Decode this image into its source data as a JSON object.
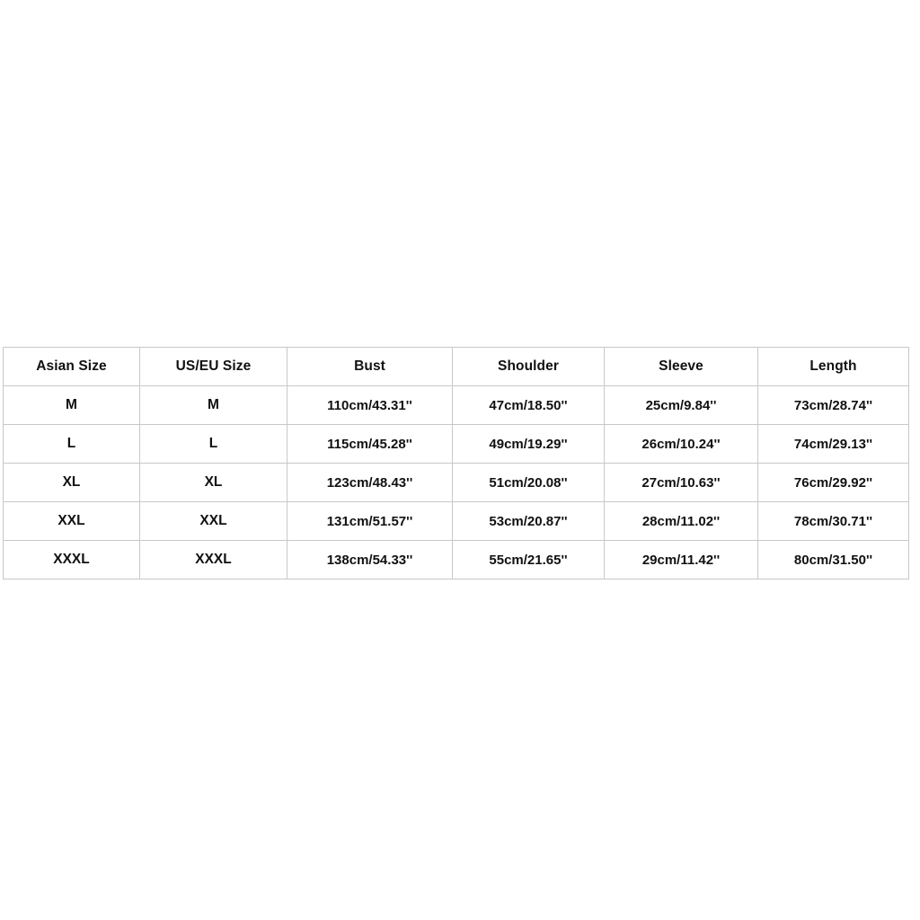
{
  "chart_data": {
    "type": "table",
    "title": "",
    "columns": [
      "Asian Size",
      "US/EU Size",
      "Bust",
      "Shoulder",
      "Sleeve",
      "Length"
    ],
    "rows": [
      [
        "M",
        "M",
        "110cm/43.31''",
        "47cm/18.50''",
        "25cm/9.84''",
        "73cm/28.74''"
      ],
      [
        "L",
        "L",
        "115cm/45.28''",
        "49cm/19.29''",
        "26cm/10.24''",
        "74cm/29.13''"
      ],
      [
        "XL",
        "XL",
        "123cm/48.43''",
        "51cm/20.08''",
        "27cm/10.63''",
        "76cm/29.92''"
      ],
      [
        "XXL",
        "XXL",
        "131cm/51.57''",
        "53cm/20.87''",
        "28cm/11.02''",
        "78cm/30.71''"
      ],
      [
        "XXXL",
        "XXXL",
        "138cm/54.33''",
        "55cm/21.65''",
        "29cm/11.42''",
        "80cm/31.50''"
      ]
    ]
  },
  "table": {
    "headers": [
      {
        "label": "Asian Size",
        "key": "asian-size"
      },
      {
        "label": "US/EU Size",
        "key": "us-eu-size"
      },
      {
        "label": "Bust",
        "key": "bust"
      },
      {
        "label": "Shoulder",
        "key": "shoulder"
      },
      {
        "label": "Sleeve",
        "key": "sleeve"
      },
      {
        "label": "Length",
        "key": "length"
      }
    ],
    "rows": [
      {
        "asian_size": "M",
        "us_eu_size": "M",
        "bust": "110cm/43.31''",
        "shoulder": "47cm/18.50''",
        "sleeve": "25cm/9.84''",
        "length": "73cm/28.74''"
      },
      {
        "asian_size": "L",
        "us_eu_size": "L",
        "bust": "115cm/45.28''",
        "shoulder": "49cm/19.29''",
        "sleeve": "26cm/10.24''",
        "length": "74cm/29.13''"
      },
      {
        "asian_size": "XL",
        "us_eu_size": "XL",
        "bust": "123cm/48.43''",
        "shoulder": "51cm/20.08''",
        "sleeve": "27cm/10.63''",
        "length": "76cm/29.92''"
      },
      {
        "asian_size": "XXL",
        "us_eu_size": "XXL",
        "bust": "131cm/51.57''",
        "shoulder": "53cm/20.87''",
        "sleeve": "28cm/11.02''",
        "length": "78cm/30.71''"
      },
      {
        "asian_size": "XXXL",
        "us_eu_size": "XXXL",
        "bust": "138cm/54.33''",
        "shoulder": "55cm/21.65''",
        "sleeve": "29cm/11.42''",
        "length": "80cm/31.50''"
      }
    ]
  },
  "colors": {
    "page_background": "#ffffff",
    "cell_background": "#ffffff",
    "grid_line": "#c8c8c8",
    "outer_border": "#b4b4b4",
    "text": "#111111"
  }
}
